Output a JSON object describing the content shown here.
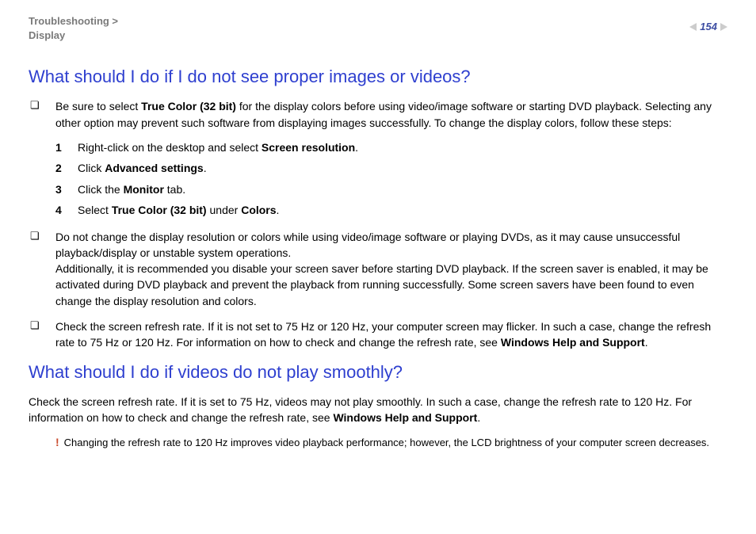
{
  "breadcrumb": {
    "line1": "Troubleshooting >",
    "line2": "Display"
  },
  "page_number": "154",
  "section1": {
    "heading": "What should I do if I do not see proper images or videos?",
    "bullet1": {
      "pre": "Be sure to select ",
      "bold1": "True Color (32 bit)",
      "post": " for the display colors before using video/image software or starting DVD playback. Selecting any other option may prevent such software from displaying images successfully. To change the display colors, follow these steps:"
    },
    "steps": [
      {
        "n": "1",
        "pre": "Right-click on the desktop and select ",
        "bold": "Screen resolution",
        "post": "."
      },
      {
        "n": "2",
        "pre": "Click ",
        "bold": "Advanced settings",
        "post": "."
      },
      {
        "n": "3",
        "pre": "Click the ",
        "bold": "Monitor",
        "post": " tab."
      },
      {
        "n": "4",
        "pre": "Select ",
        "bold": "True Color (32 bit)",
        "mid": " under ",
        "bold2": "Colors",
        "post": "."
      }
    ],
    "bullet2": "Do not change the display resolution or colors while using video/image software or playing DVDs, as it may cause unsuccessful playback/display or unstable system operations.",
    "bullet2b": "Additionally, it is recommended you disable your screen saver before starting DVD playback. If the screen saver is enabled, it may be activated during DVD playback and prevent the playback from running successfully. Some screen savers have been found to even change the display resolution and colors.",
    "bullet3": {
      "pre": "Check the screen refresh rate. If it is not set to 75 Hz or 120 Hz, your computer screen may flicker. In such a case, change the refresh rate to 75 Hz or 120 Hz. For information on how to check and change the refresh rate, see ",
      "bold": "Windows Help and Support",
      "post": "."
    }
  },
  "section2": {
    "heading": "What should I do if videos do not play smoothly?",
    "body": {
      "pre": "Check the screen refresh rate. If it is set to 75 Hz, videos may not play smoothly. In such a case, change the refresh rate to 120 Hz. For information on how to check and change the refresh rate, see ",
      "bold": "Windows Help and Support",
      "post": "."
    },
    "note": "Changing the refresh rate to 120 Hz improves video playback performance; however, the LCD brightness of your computer screen decreases."
  }
}
